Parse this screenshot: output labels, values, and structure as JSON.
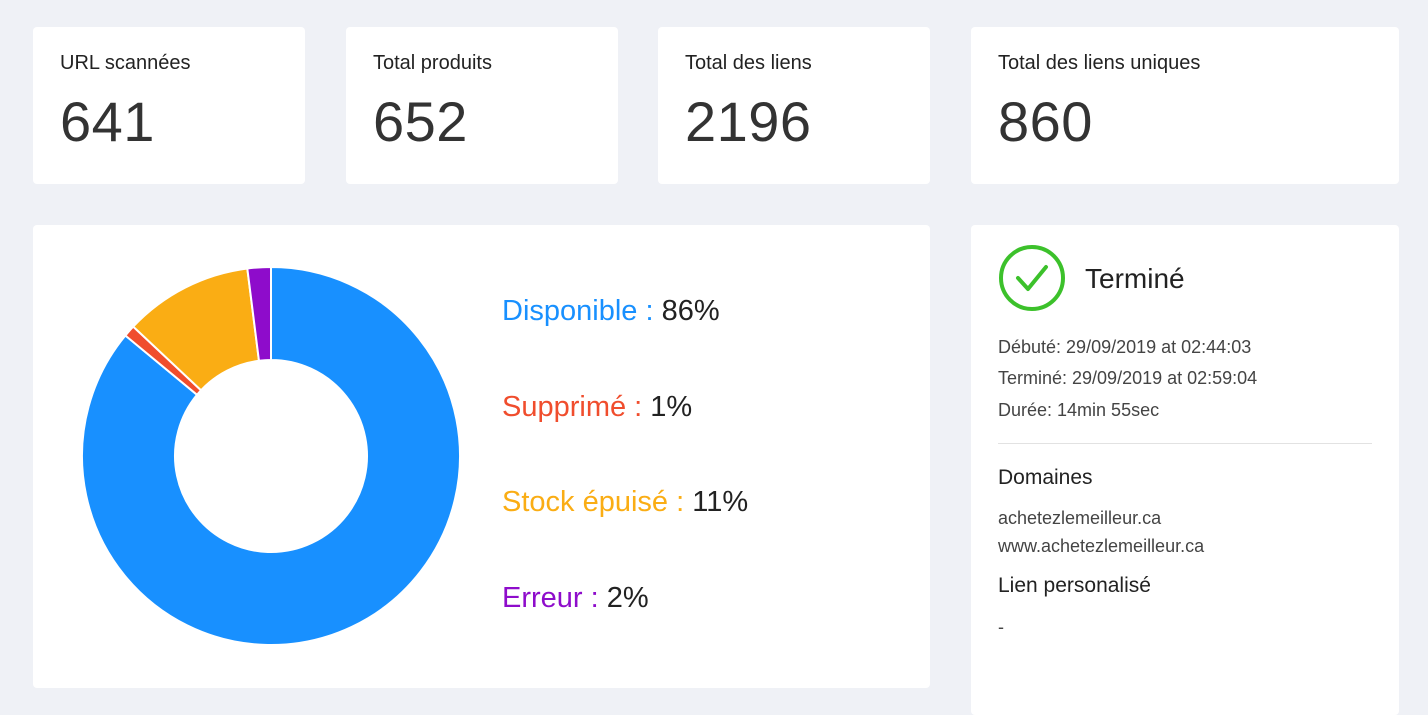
{
  "stats": [
    {
      "label": "URL scannées",
      "value": "641"
    },
    {
      "label": "Total produits",
      "value": "652"
    },
    {
      "label": "Total des liens",
      "value": "2196"
    },
    {
      "label": "Total des liens uniques",
      "value": "860"
    }
  ],
  "chart_data": {
    "type": "pie",
    "categories": [
      "Disponible",
      "Supprimé",
      "Stock épuisé",
      "Erreur"
    ],
    "values": [
      86,
      1,
      11,
      2
    ],
    "colors": [
      "#1890ff",
      "#f04d2d",
      "#faad14",
      "#8e0ccb"
    ]
  },
  "legend": [
    {
      "label": "Disponible :",
      "pct": "86%",
      "color": "#1890ff"
    },
    {
      "label": "Supprimé :",
      "pct": "1%",
      "color": "#f04d2d"
    },
    {
      "label": "Stock épuisé :",
      "pct": "11%",
      "color": "#faad14"
    },
    {
      "label": "Erreur :",
      "pct": "2%",
      "color": "#8e0ccb"
    }
  ],
  "status": {
    "icon": "check-circle-icon",
    "icon_color": "#3cc12b",
    "title": "Terminé",
    "started": "Débuté: 29/09/2019 at 02:44:03",
    "finished": "Terminé: 29/09/2019 at 02:59:04",
    "duration": "Durée: 14min 55sec",
    "domains_title": "Domaines",
    "domains": [
      "achetezlemeilleur.ca",
      "www.achetezlemeilleur.ca"
    ],
    "custom_link_title": "Lien personalisé",
    "custom_link_value": "-"
  }
}
